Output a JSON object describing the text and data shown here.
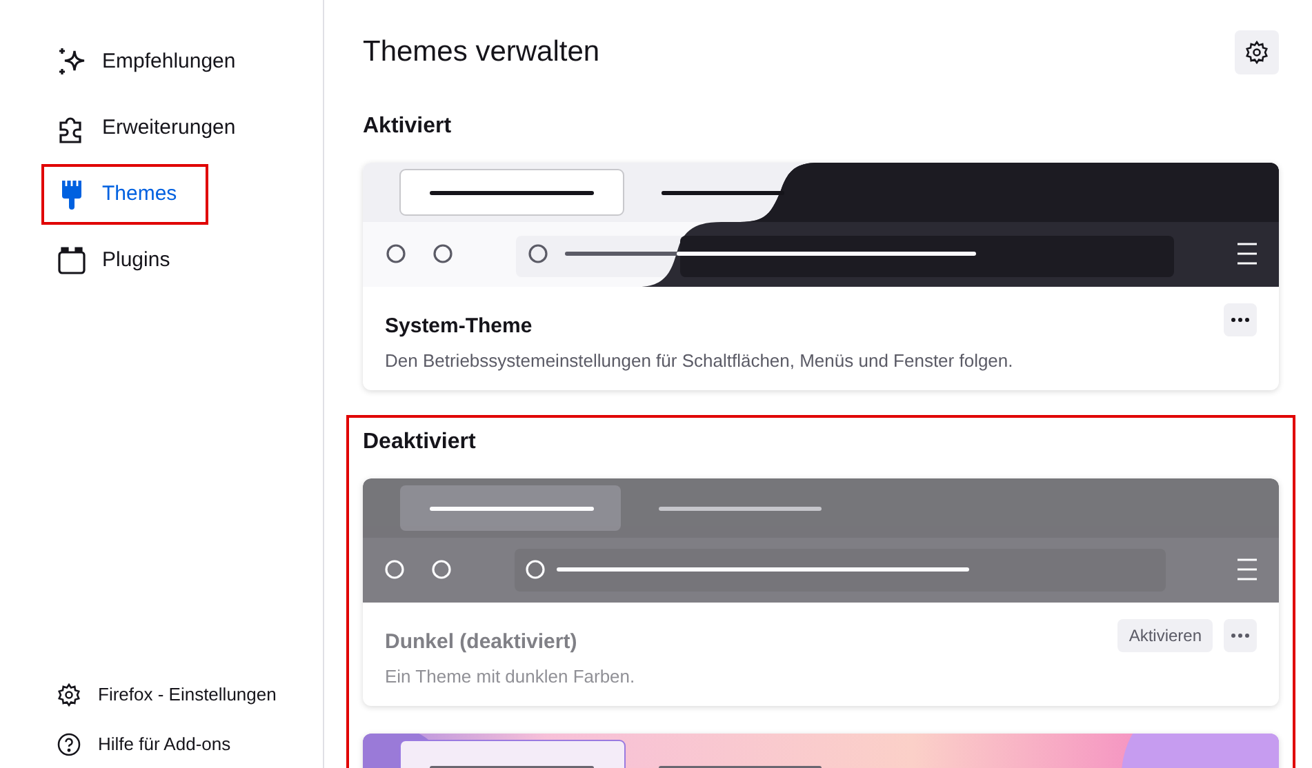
{
  "sidebar": {
    "items": [
      {
        "label": "Empfehlungen",
        "selected": false,
        "highlighted": false
      },
      {
        "label": "Erweiterungen",
        "selected": false,
        "highlighted": false
      },
      {
        "label": "Themes",
        "selected": true,
        "highlighted": true
      },
      {
        "label": "Plugins",
        "selected": false,
        "highlighted": false
      }
    ],
    "footer": [
      {
        "label": "Firefox - Einstellungen"
      },
      {
        "label": "Hilfe für Add-ons"
      }
    ]
  },
  "header": {
    "title": "Themes verwalten"
  },
  "sections": [
    {
      "heading": "Aktiviert",
      "highlighted": false,
      "themes": [
        {
          "kind": "system",
          "name": "System-Theme",
          "description": "Den Betriebssystemeinstellungen für Schaltflächen, Menüs und Fenster folgen.",
          "disabled": false
        }
      ]
    },
    {
      "heading": "Deaktiviert",
      "highlighted": true,
      "themes": [
        {
          "kind": "dark",
          "name": "Dunkel (deaktiviert)",
          "description": "Ein Theme mit dunklen Farben.",
          "disabled": true,
          "action": "Aktivieren"
        },
        {
          "kind": "colorful",
          "disabled": false
        }
      ]
    }
  ]
}
